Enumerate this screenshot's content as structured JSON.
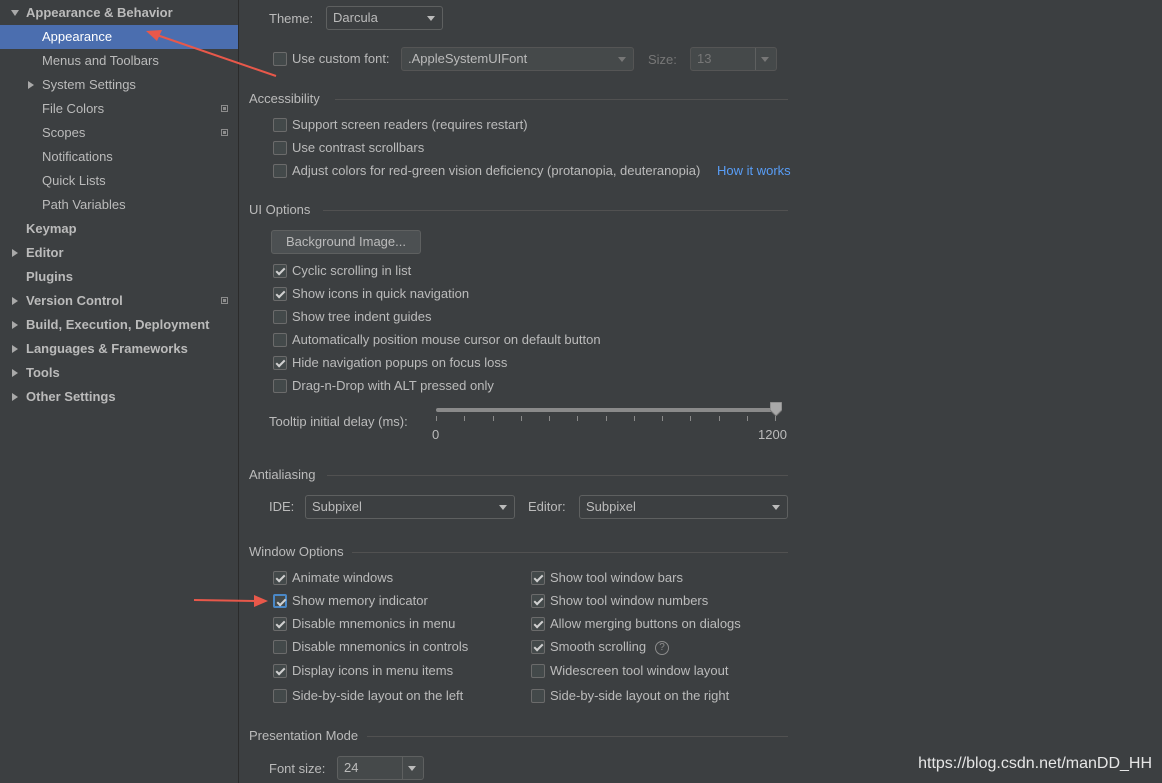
{
  "sidebar": {
    "items": [
      {
        "label": "Appearance & Behavior"
      },
      {
        "label": "Appearance"
      },
      {
        "label": "Menus and Toolbars"
      },
      {
        "label": "System Settings"
      },
      {
        "label": "File Colors"
      },
      {
        "label": "Scopes"
      },
      {
        "label": "Notifications"
      },
      {
        "label": "Quick Lists"
      },
      {
        "label": "Path Variables"
      },
      {
        "label": "Keymap"
      },
      {
        "label": "Editor"
      },
      {
        "label": "Plugins"
      },
      {
        "label": "Version Control"
      },
      {
        "label": "Build, Execution, Deployment"
      },
      {
        "label": "Languages & Frameworks"
      },
      {
        "label": "Tools"
      },
      {
        "label": "Other Settings"
      }
    ]
  },
  "theme": {
    "label": "Theme:",
    "value": "Darcula"
  },
  "custom_font": {
    "label": "Use custom font:",
    "font_value": ".AppleSystemUIFont",
    "size_label": "Size:",
    "size_value": "13"
  },
  "accessibility": {
    "title": "Accessibility",
    "screen_readers": "Support screen readers (requires restart)",
    "contrast_scrollbars": "Use contrast scrollbars",
    "adjust_colors": "Adjust colors for red-green vision deficiency (protanopia, deuteranopia)",
    "how_it_works": "How it works"
  },
  "ui_options": {
    "title": "UI Options",
    "background_image": "Background Image...",
    "cyclic_scrolling": "Cyclic scrolling in list",
    "show_icons_quick_nav": "Show icons in quick navigation",
    "show_tree_indent": "Show tree indent guides",
    "auto_position_mouse": "Automatically position mouse cursor on default button",
    "hide_nav_popups": "Hide navigation popups on focus loss",
    "drag_n_drop_alt": "Drag-n-Drop with ALT pressed only",
    "tooltip_delay_label": "Tooltip initial delay (ms):",
    "tooltip_min": "0",
    "tooltip_max": "1200",
    "tooltip_value": 1200
  },
  "antialiasing": {
    "title": "Antialiasing",
    "ide_label": "IDE:",
    "ide_value": "Subpixel",
    "editor_label": "Editor:",
    "editor_value": "Subpixel"
  },
  "window_options": {
    "title": "Window Options",
    "animate_windows": "Animate windows",
    "show_memory_indicator": "Show memory indicator",
    "disable_mnemonics_menu": "Disable mnemonics in menu",
    "disable_mnemonics_controls": "Disable mnemonics in controls",
    "display_icons_menu": "Display icons in menu items",
    "side_by_side_left": "Side-by-side layout on the left",
    "show_tool_window_bars": "Show tool window bars",
    "show_tool_window_numbers": "Show tool window numbers",
    "allow_merging_buttons": "Allow merging buttons on dialogs",
    "smooth_scrolling": "Smooth scrolling",
    "widescreen_layout": "Widescreen tool window layout",
    "side_by_side_right": "Side-by-side layout on the right"
  },
  "presentation_mode": {
    "title": "Presentation Mode",
    "font_size_label": "Font size:",
    "font_size_value": "24"
  },
  "watermark": "https://blog.csdn.net/manDD_HH",
  "colors": {
    "selection": "#4b6eaf",
    "link": "#589df6",
    "annotation_arrow": "#e8584a",
    "background": "#3c3f41"
  }
}
